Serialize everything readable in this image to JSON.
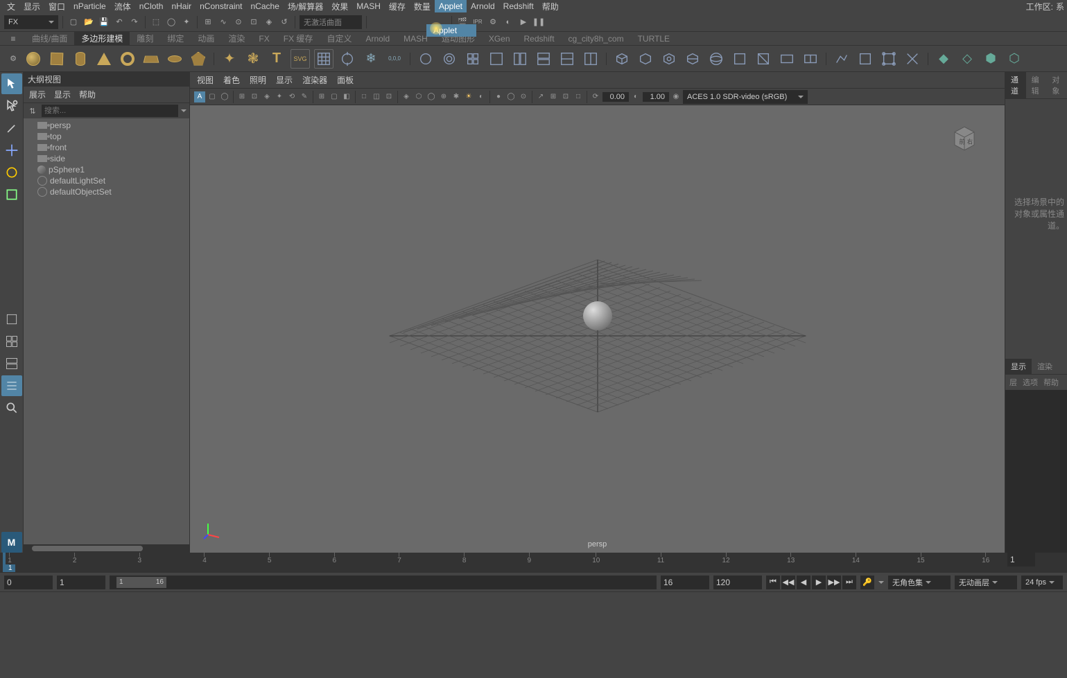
{
  "topmenu": {
    "items": [
      "文",
      "显示",
      "窗口",
      "nParticle",
      "流体",
      "nCloth",
      "nHair",
      "nConstraint",
      "nCache",
      "场/解算器",
      "效果",
      "MASH",
      "缓存",
      "数量",
      "Applet",
      "Arnold",
      "Redshift",
      "帮助"
    ],
    "active_index": 14,
    "right": {
      "workspace_label": "工作区:",
      "workspace_value": "系"
    }
  },
  "toolbar1": {
    "mode_dropdown": "FX",
    "curve_field": "无激活曲面",
    "applet_tooltip": "Applet"
  },
  "shelf": {
    "tabs": [
      "曲线/曲面",
      "多边形建模",
      "雕刻",
      "绑定",
      "动画",
      "渲染",
      "FX",
      "FX 缓存",
      "自定义",
      "Arnold",
      "MASH",
      "运动图形",
      "XGen",
      "Redshift",
      "cg_city8h_com",
      "TURTLE"
    ],
    "active_index": 1,
    "icons": [
      "sphere",
      "cube",
      "cylinder",
      "cone",
      "torus",
      "plane",
      "disc",
      "platonic",
      "star",
      "swirl",
      "text",
      "svg",
      "grid-tool",
      "target",
      "star2",
      "coord",
      "circle1",
      "circle2",
      "quad1",
      "quad2",
      "quad3",
      "quad4",
      "quad5",
      "quad6",
      "cube1",
      "cube2",
      "cube3",
      "cube4",
      "sphere2",
      "cube5",
      "cube6",
      "box1",
      "box2",
      "line1",
      "line2",
      "line3",
      "line4",
      "sq1",
      "sq2",
      "sq3",
      "sq4"
    ],
    "svg_label": "SVG",
    "coord_label": "0,0,0"
  },
  "outliner": {
    "title": "大纲视图",
    "menu": [
      "展示",
      "显示",
      "帮助"
    ],
    "search_placeholder": "搜索...",
    "items": [
      {
        "type": "cam",
        "label": "persp"
      },
      {
        "type": "cam",
        "label": "top"
      },
      {
        "type": "cam",
        "label": "front"
      },
      {
        "type": "cam",
        "label": "side"
      },
      {
        "type": "sphere",
        "label": "pSphere1"
      },
      {
        "type": "set",
        "label": "defaultLightSet"
      },
      {
        "type": "set",
        "label": "defaultObjectSet"
      }
    ]
  },
  "viewport": {
    "menu": [
      "视图",
      "着色",
      "照明",
      "显示",
      "渲染器",
      "面板"
    ],
    "num1": "0.00",
    "num2": "1.00",
    "colorspace": "ACES 1.0 SDR-video (sRGB)",
    "camera_label": "persp",
    "viewcube": {
      "face1": "前",
      "face2": "右"
    }
  },
  "right": {
    "tabs1": [
      "通道",
      "编辑",
      "对象"
    ],
    "active1": 0,
    "hint": "选择场景中的对象或属性通道。",
    "tabs2": [
      "显示",
      "渲染"
    ],
    "active2": 0,
    "menu2": [
      "层",
      "选项",
      "帮助"
    ]
  },
  "timeline": {
    "start": "1",
    "ticks": [
      "1",
      "2",
      "3",
      "4",
      "5",
      "6",
      "7",
      "8",
      "9",
      "10",
      "11",
      "12",
      "13",
      "14",
      "15",
      "16"
    ],
    "current": "1",
    "end_field": "1"
  },
  "range": {
    "start_outer": "0",
    "start_inner": "1",
    "thumb_start": "1",
    "thumb_end": "16",
    "end_inner": "16",
    "end_outer": "120",
    "charset": "无角色集",
    "animlayer": "无动画层",
    "fps": "24 fps"
  }
}
